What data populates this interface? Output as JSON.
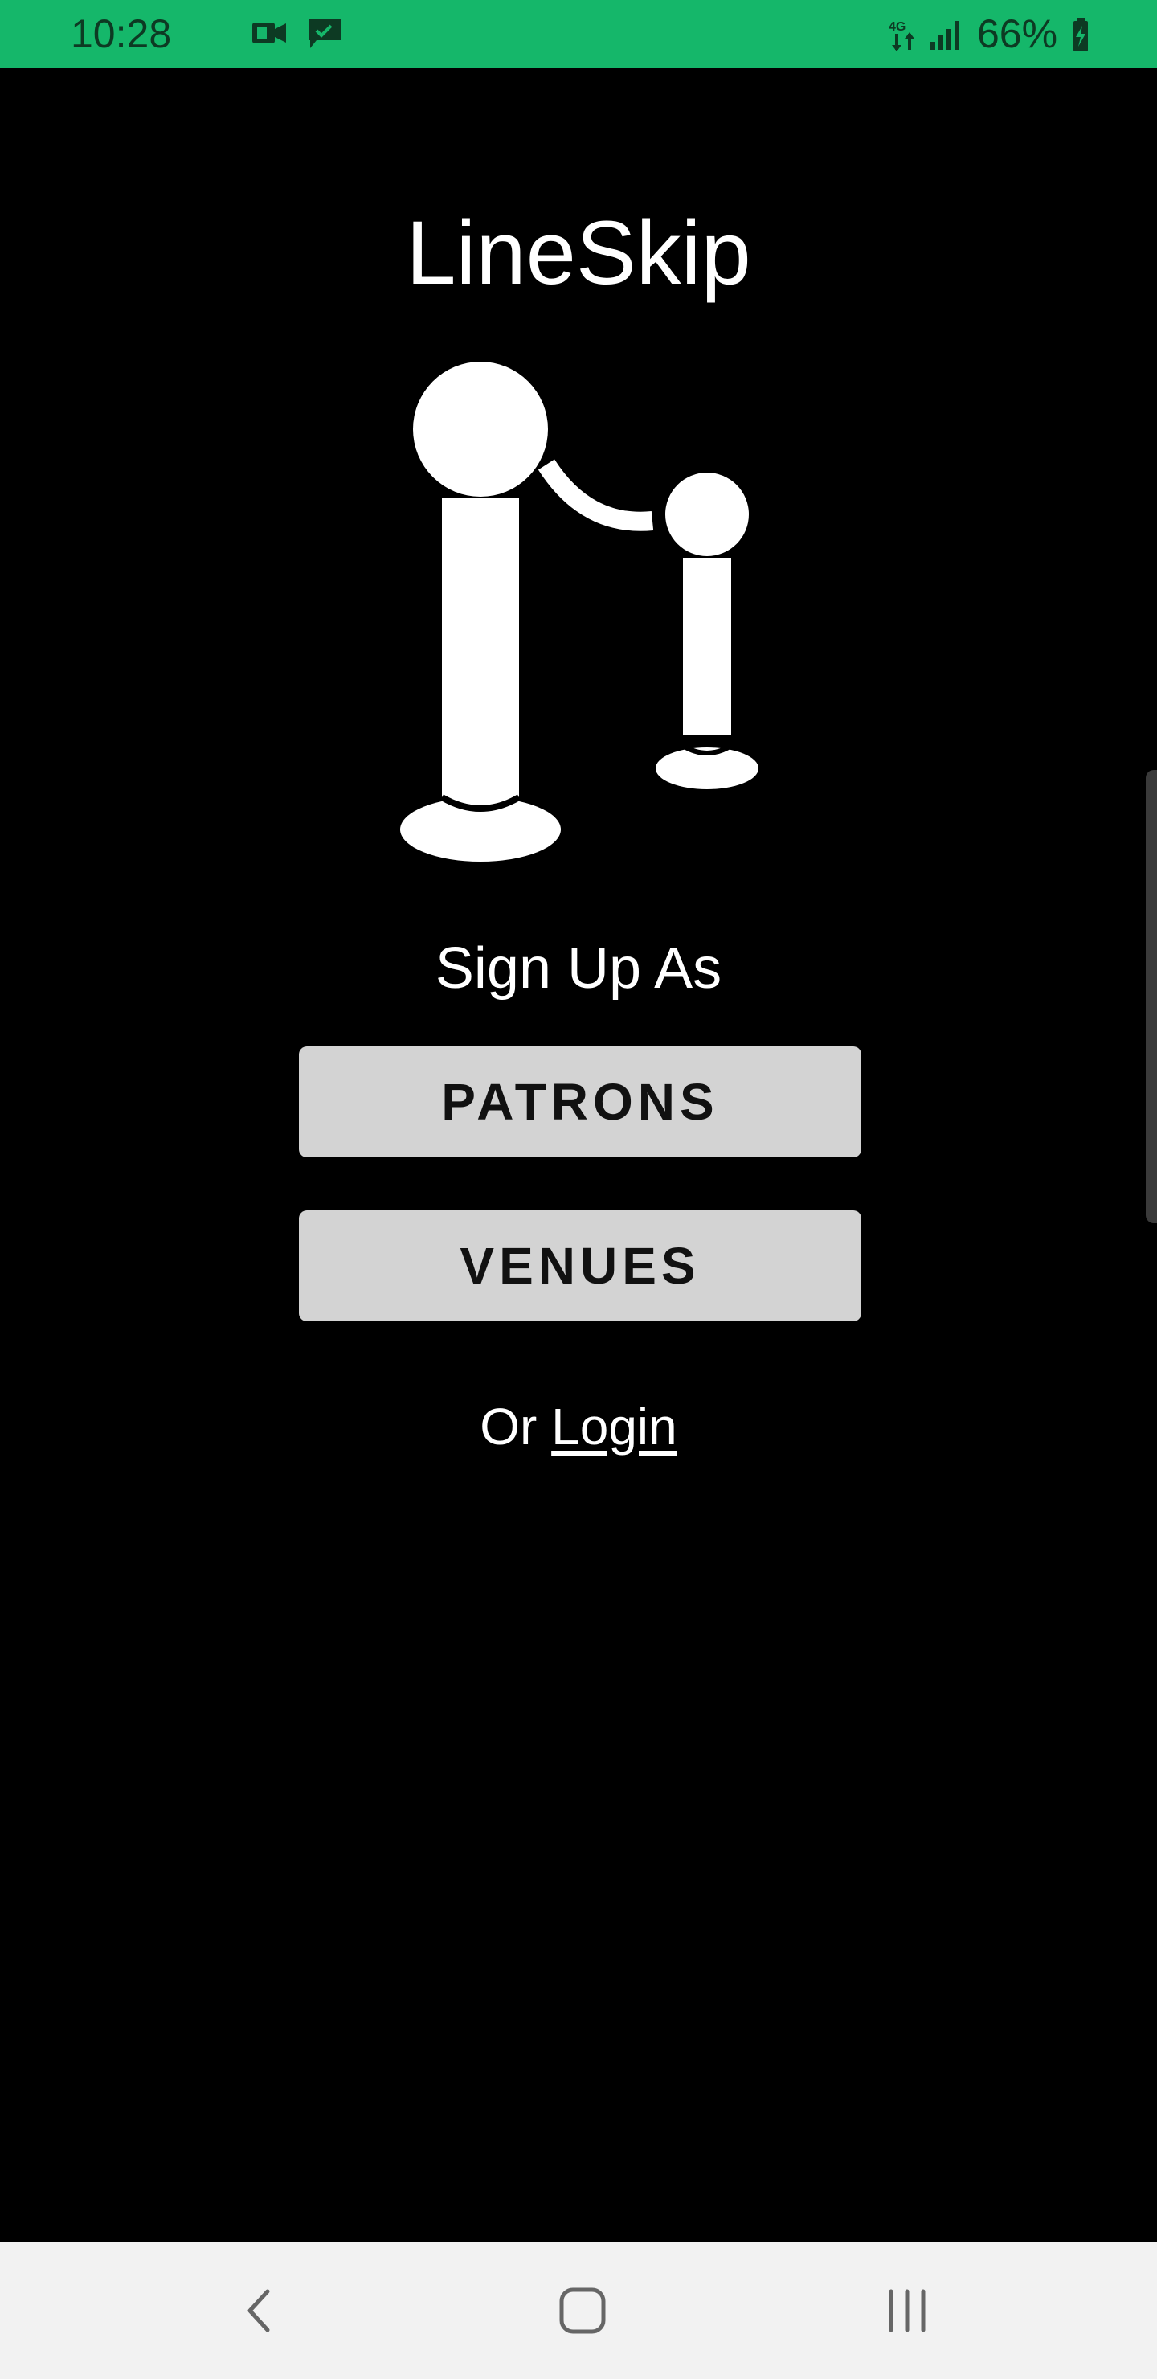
{
  "status_bar": {
    "time": "10:28",
    "battery_percent": "66%",
    "left_icons": [
      "video-call-icon",
      "message-icon"
    ],
    "right_icons": [
      "data-transfer-icon",
      "signal-icon",
      "battery-charging-icon"
    ],
    "background": "#15b76a"
  },
  "app": {
    "title": "LineSkip",
    "logo_icon": "velvet-rope-stanchion-icon"
  },
  "signup": {
    "heading": "Sign Up As",
    "patrons_label": "PATRONS",
    "venues_label": "VENUES",
    "or_text": "Or",
    "login_label": "Login"
  },
  "nav_bar": {
    "buttons": [
      "back-icon",
      "home-icon",
      "recents-icon"
    ]
  },
  "colors": {
    "background": "#000000",
    "button_bg": "#d3d3d3",
    "text": "#ffffff"
  }
}
